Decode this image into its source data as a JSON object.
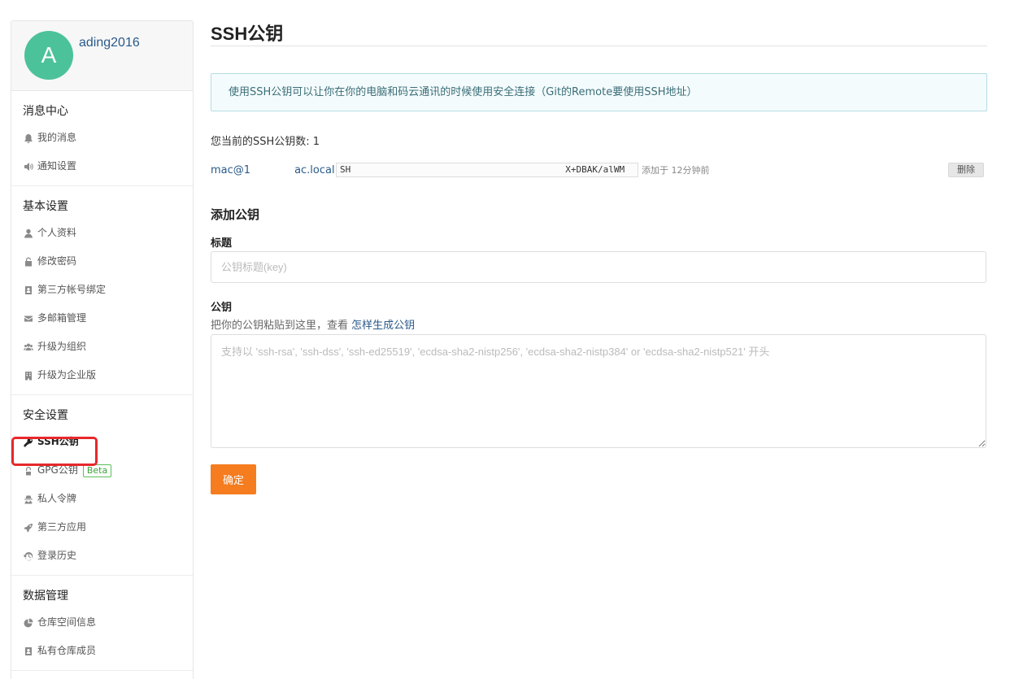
{
  "profile": {
    "avatar_letter": "A",
    "username": "ading2016"
  },
  "sidebar": {
    "sections": [
      {
        "title": "消息中心",
        "items": [
          {
            "label": "我的消息",
            "icon": "bell-icon"
          },
          {
            "label": "通知设置",
            "icon": "speaker-icon"
          }
        ]
      },
      {
        "title": "基本设置",
        "items": [
          {
            "label": "个人资料",
            "icon": "user-icon"
          },
          {
            "label": "修改密码",
            "icon": "unlock-icon"
          },
          {
            "label": "第三方帐号绑定",
            "icon": "contact-icon"
          },
          {
            "label": "多邮箱管理",
            "icon": "envelope-icon"
          },
          {
            "label": "升级为组织",
            "icon": "users-icon"
          },
          {
            "label": "升级为企业版",
            "icon": "building-icon"
          }
        ]
      },
      {
        "title": "安全设置",
        "items": [
          {
            "label": "SSH公钥",
            "icon": "key-icon",
            "active": true
          },
          {
            "label": "GPG公钥",
            "icon": "gpg-icon",
            "badge": "Beta"
          },
          {
            "label": "私人令牌",
            "icon": "user-secret-icon"
          },
          {
            "label": "第三方应用",
            "icon": "rocket-icon"
          },
          {
            "label": "登录历史",
            "icon": "history-icon"
          }
        ]
      },
      {
        "title": "数据管理",
        "items": [
          {
            "label": "仓库空间信息",
            "icon": "pie-chart-icon"
          },
          {
            "label": "私有仓库成员",
            "icon": "contact-icon"
          }
        ]
      }
    ]
  },
  "main": {
    "title": "SSH公钥",
    "info": "使用SSH公钥可以让你在你的电脑和码云通讯的时候使用安全连接（Git的Remote要使用SSH地址）",
    "key_count_label": "您当前的SSH公钥数: 1",
    "keys": [
      {
        "title_start": "mac@1",
        "title_end": "ac.local",
        "fp_start": "SH",
        "fp_end": "X+DBAK/alWM",
        "time": "添加于 12分钟前",
        "delete_label": "删除"
      }
    ],
    "add_title": "添加公钥",
    "form": {
      "title_label": "标题",
      "title_placeholder": "公钥标题(key)",
      "key_label": "公钥",
      "hint_text": "把你的公钥粘贴到这里，查看 ",
      "hint_link": "怎样生成公钥",
      "key_placeholder": "支持以 'ssh-rsa', 'ssh-dss', 'ssh-ed25519', 'ecdsa-sha2-nistp256', 'ecdsa-sha2-nistp384' or 'ecdsa-sha2-nistp521' 开头",
      "submit_label": "确定"
    }
  }
}
